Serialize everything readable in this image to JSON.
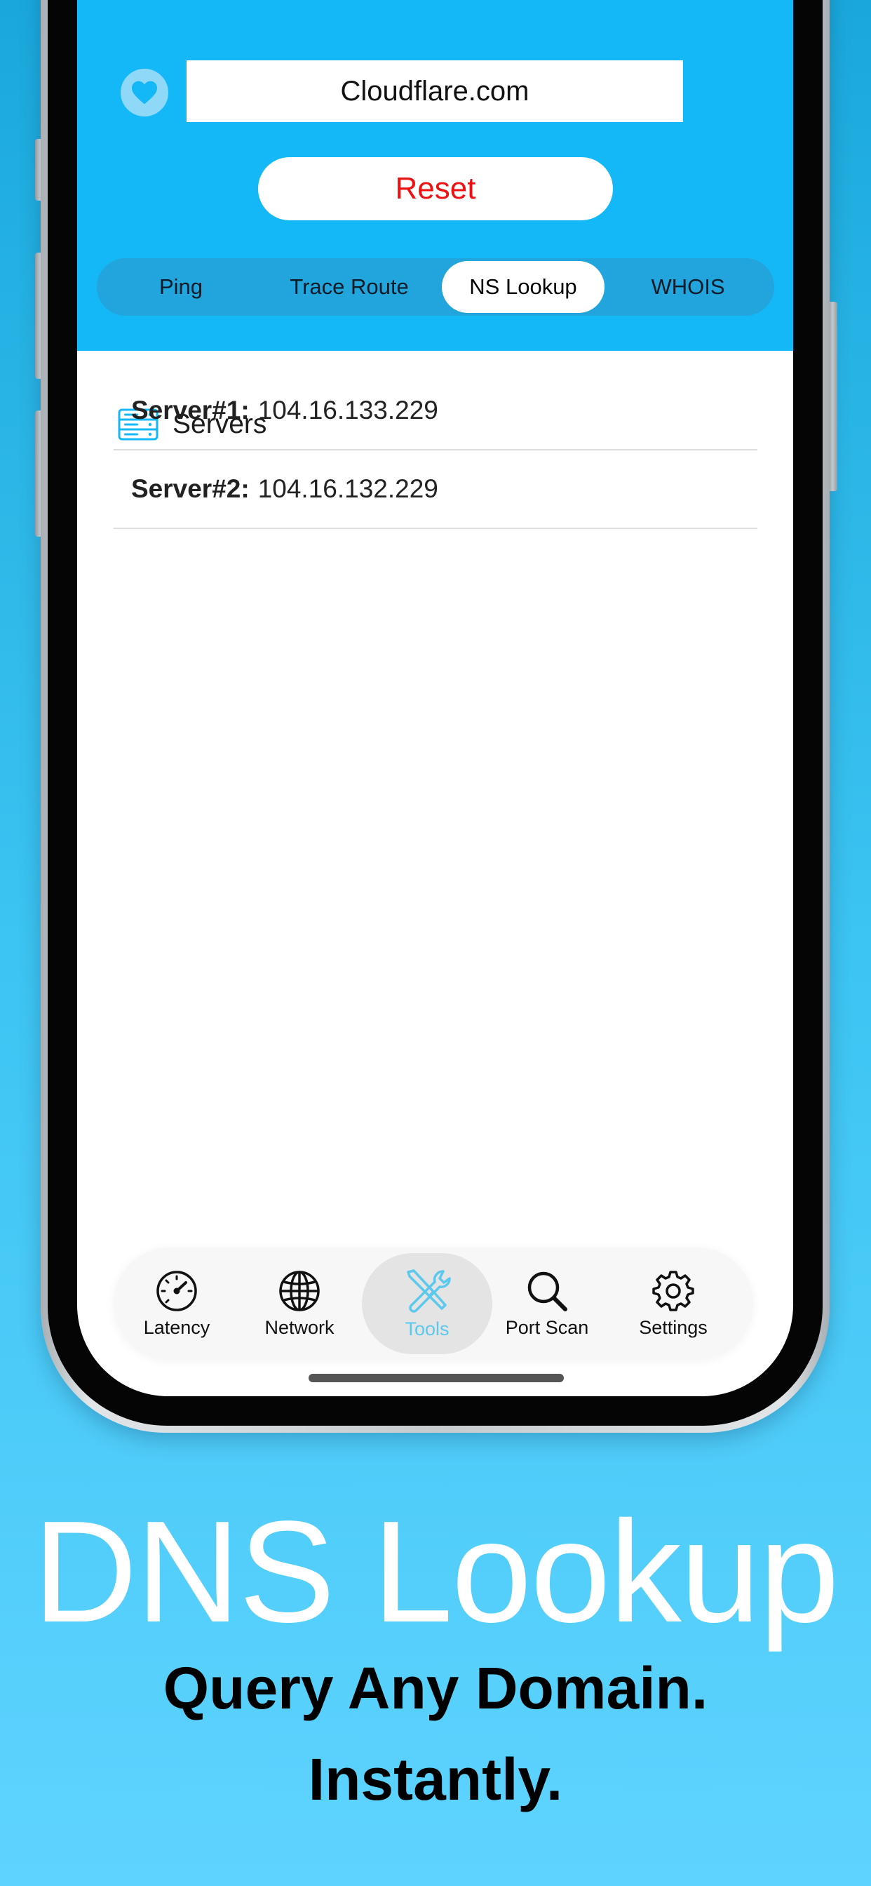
{
  "search": {
    "domain": "Cloudflare.com"
  },
  "reset_label": "Reset",
  "segments": [
    "Ping",
    "Trace Route",
    "NS Lookup",
    "WHOIS"
  ],
  "active_segment": "NS Lookup",
  "section_title": "Servers",
  "servers": [
    {
      "label": "Server#1:",
      "value": "104.16.133.229"
    },
    {
      "label": "Server#2:",
      "value": "104.16.132.229"
    }
  ],
  "tabs": [
    "Latency",
    "Network",
    "Tools",
    "Port Scan",
    "Settings"
  ],
  "active_tab": "Tools",
  "headline": "DNS Lookup",
  "subline": [
    "Query Any Domain.",
    "Instantly."
  ],
  "colors": {
    "accent": "#14b8f6",
    "reset": "#ee1111",
    "active_tab": "#5dc8ee"
  }
}
